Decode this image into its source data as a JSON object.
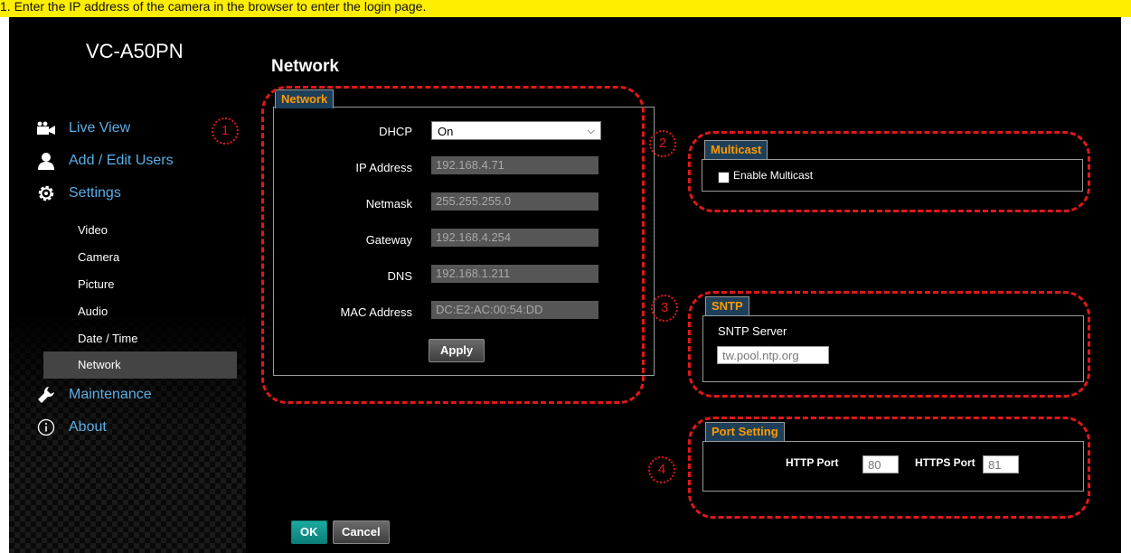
{
  "header": {
    "banner_text": "1. Enter the IP address of the camera in the browser to enter the login page."
  },
  "app": {
    "model": "VC-A50PN"
  },
  "nav": {
    "main": [
      {
        "label": "Live View",
        "icon": "camera-icon"
      },
      {
        "label": "Add / Edit Users",
        "icon": "user-icon"
      },
      {
        "label": "Settings",
        "icon": "gear-icon"
      }
    ],
    "sub": [
      "Video",
      "Camera",
      "Picture",
      "Audio",
      "Date / Time",
      "Network"
    ],
    "active_sub": "Network",
    "maintenance": {
      "label": "Maintenance",
      "icon": "wrench-icon"
    },
    "about": {
      "label": "About",
      "icon": "info-icon"
    }
  },
  "page": {
    "title": "Network"
  },
  "network_panel": {
    "tab": "Network",
    "dhcp_label": "DHCP",
    "dhcp_value": "On",
    "ip_label": "IP Address",
    "ip_value": "192.168.4.71",
    "netmask_label": "Netmask",
    "netmask_value": "255.255.255.0",
    "gateway_label": "Gateway",
    "gateway_value": "192.168.4.254",
    "dns_label": "DNS",
    "dns_value": "192.168.1.211",
    "mac_label": "MAC Address",
    "mac_value": "DC:E2:AC:00:54:DD",
    "apply_label": "Apply"
  },
  "multicast_panel": {
    "tab": "Multicast",
    "checkbox_label": "Enable Multicast",
    "checked": false
  },
  "sntp_panel": {
    "tab": "SNTP",
    "server_label": "SNTP Server",
    "server_value": "tw.pool.ntp.org"
  },
  "port_panel": {
    "tab": "Port Setting",
    "http_label": "HTTP Port",
    "http_value": "80",
    "https_label": "HTTPS Port",
    "https_value": "81"
  },
  "footer": {
    "ok_label": "OK",
    "cancel_label": "Cancel"
  },
  "callouts": [
    "1",
    "2",
    "3",
    "4"
  ],
  "colors": {
    "banner": "#ffee00",
    "accent_tab": "#ff9a00",
    "nav_link": "#5aaee6",
    "callout": "#e01818",
    "ok_button": "#1da9a0"
  }
}
